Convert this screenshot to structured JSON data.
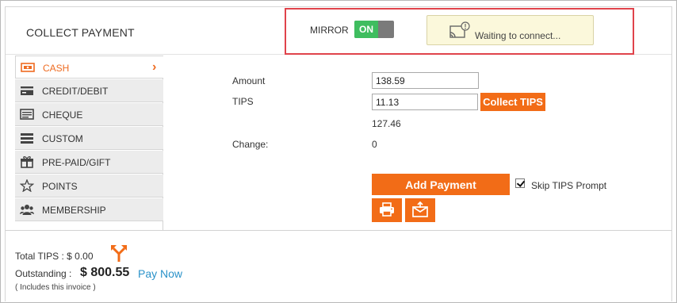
{
  "header": {
    "title": "COLLECT PAYMENT"
  },
  "mirror": {
    "label": "MIRROR",
    "toggle_label": "ON",
    "status": "Waiting to connect..."
  },
  "sidebar": {
    "items": [
      {
        "label": "CASH",
        "icon": "cash-icon",
        "active": true
      },
      {
        "label": "CREDIT/DEBIT",
        "icon": "credit-card-icon"
      },
      {
        "label": "CHEQUE",
        "icon": "cheque-icon"
      },
      {
        "label": "CUSTOM",
        "icon": "custom-icon"
      },
      {
        "label": "PRE-PAID/GIFT",
        "icon": "gift-icon"
      },
      {
        "label": "POINTS",
        "icon": "star-icon"
      },
      {
        "label": "MEMBERSHIP",
        "icon": "members-icon"
      }
    ]
  },
  "form": {
    "amount_label": "Amount",
    "amount_value": "138.59",
    "tips_label": "TIPS",
    "tips_value": "11.13",
    "collect_tips_label": "Collect TIPS",
    "subtotal_value": "127.46",
    "change_label": "Change:",
    "change_value": "0",
    "add_payment_label": "Add Payment",
    "skip_tips_label": "Skip TIPS Prompt",
    "skip_tips_checked": true
  },
  "footer": {
    "total_tips": "Total TIPS : $ 0.00",
    "outstanding_label": "Outstanding :",
    "outstanding_amount": "$ 800.55",
    "pay_now_label": "Pay Now",
    "includes_note": "( Includes this invoice )"
  },
  "colors": {
    "accent": "#f26c17",
    "toggle_on": "#3fbd5f",
    "highlight_border": "#e0434b",
    "link": "#2a92c9"
  }
}
